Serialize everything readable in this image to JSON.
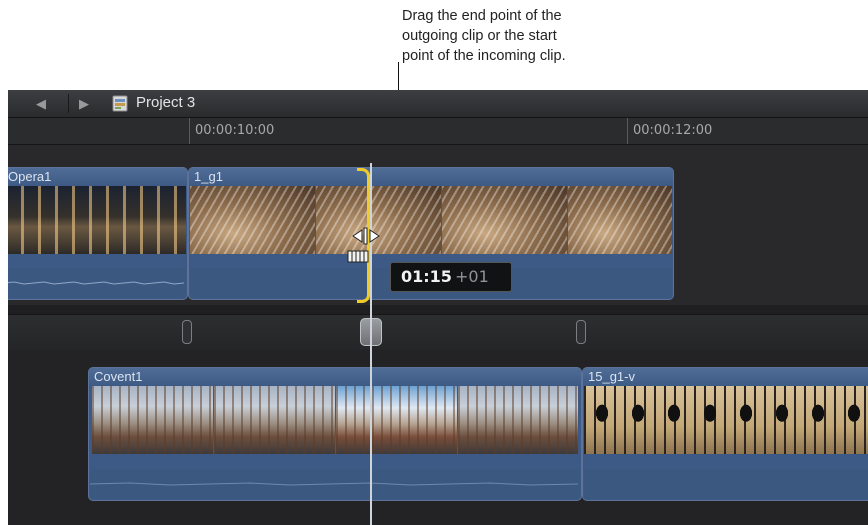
{
  "callout": {
    "lines": [
      "Drag the end point of the",
      "outgoing clip or the start",
      "point of the incoming clip."
    ]
  },
  "titlebar": {
    "back_icon": "back-arrow-icon",
    "forward_icon": "forward-arrow-icon",
    "project_icon": "project-icon",
    "project_name": "Project 3"
  },
  "ruler": {
    "ticks": [
      "00:00:10:00",
      "00:00:12:00"
    ]
  },
  "clips": {
    "opera": {
      "name": "Opera1"
    },
    "g1": {
      "name": "1_g1"
    },
    "covent": {
      "name": "Covent1"
    },
    "g1v": {
      "name": "15_g1-v"
    }
  },
  "timecode": {
    "value": "01:15",
    "delta": "+01"
  },
  "colors": {
    "clip_blue": "#3d5a86",
    "edit_bracket": "#f0cc28",
    "timeline_bg": "#1f1f21"
  }
}
